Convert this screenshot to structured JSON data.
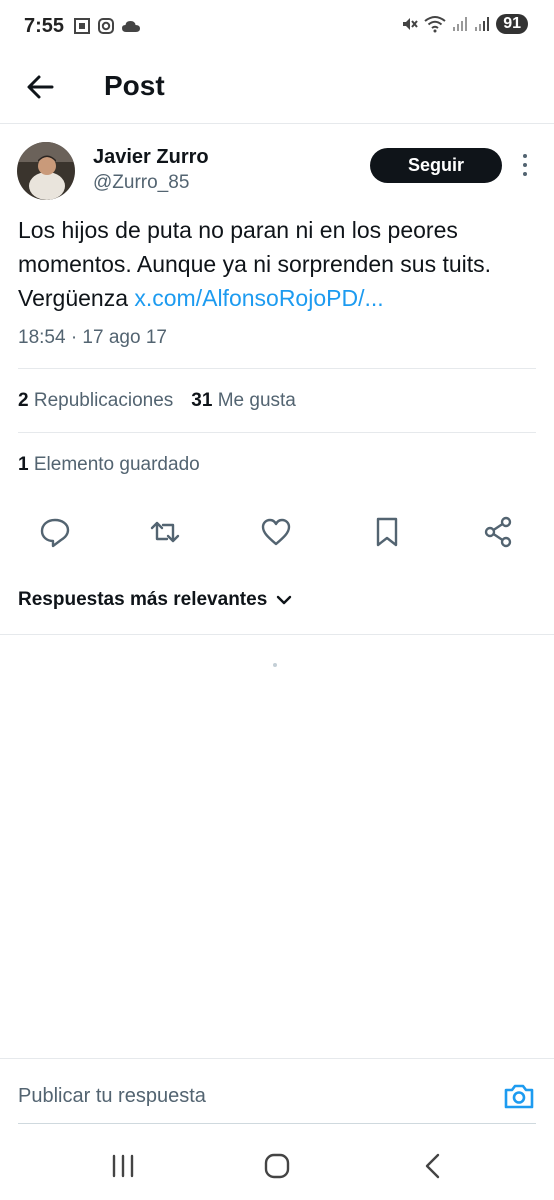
{
  "status_bar": {
    "time": "7:55",
    "battery": "91",
    "left_icons": [
      "screenshot-icon",
      "instagram-icon",
      "cloud-icon"
    ],
    "right_icons": [
      "mute-icon",
      "wifi-icon",
      "signal-icon",
      "signal-icon"
    ]
  },
  "header": {
    "title": "Post"
  },
  "post": {
    "author_name": "Javier Zurro",
    "author_handle": "@Zurro_85",
    "follow_label": "Seguir",
    "text_before_link": "Los hijos de puta no paran ni en los peores momentos. Aunque ya ni sorprenden sus tuits. Vergüenza ",
    "link_text": "x.com/AlfonsoRojoPD/...",
    "timestamp": "18:54 · 17 ago 17"
  },
  "stats": {
    "reposts_count": "2",
    "reposts_label": "Republicaciones",
    "likes_count": "31",
    "likes_label": "Me gusta",
    "saved_count": "1",
    "saved_label": "Elemento guardado"
  },
  "actions": [
    "reply-icon",
    "repost-icon",
    "like-icon",
    "bookmark-icon",
    "share-icon"
  ],
  "replies": {
    "sort_label": "Respuestas más relevantes"
  },
  "reply_bar": {
    "placeholder": "Publicar tu respuesta"
  },
  "colors": {
    "accent": "#1d9bf0",
    "text": "#0f1419",
    "secondary": "#536471",
    "divider": "#e6e9ec"
  }
}
